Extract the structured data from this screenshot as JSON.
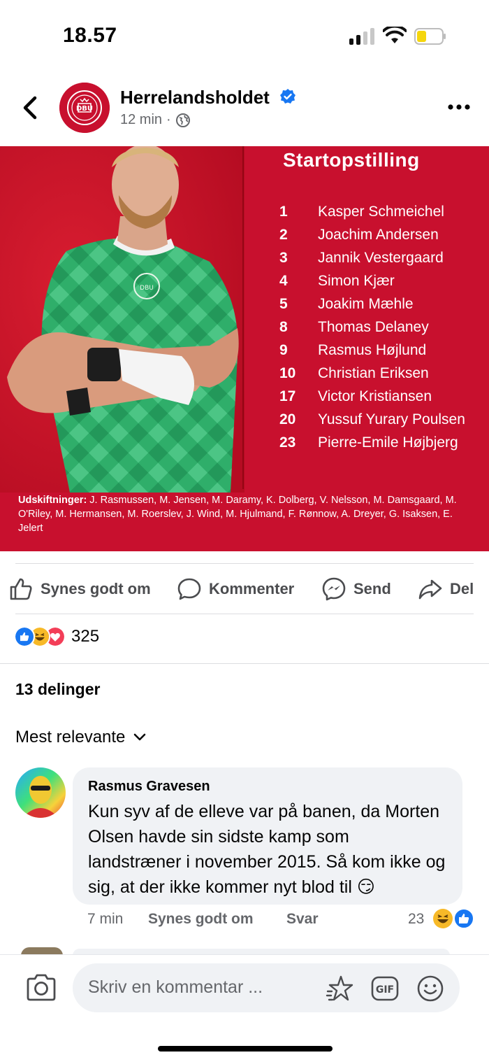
{
  "status_bar": {
    "time": "18.57"
  },
  "post": {
    "page_name": "Herrelandsholdet",
    "age": "12 min",
    "dot": "·"
  },
  "graphic": {
    "title": "Startopstilling",
    "lineup": [
      {
        "num": "1",
        "name": "Kasper Schmeichel"
      },
      {
        "num": "2",
        "name": "Joachim Andersen"
      },
      {
        "num": "3",
        "name": "Jannik Vestergaard"
      },
      {
        "num": "4",
        "name": "Simon Kjær"
      },
      {
        "num": "5",
        "name": "Joakim Mæhle"
      },
      {
        "num": "8",
        "name": "Thomas Delaney"
      },
      {
        "num": "9",
        "name": "Rasmus Højlund"
      },
      {
        "num": "10",
        "name": "Christian Eriksen"
      },
      {
        "num": "17",
        "name": "Victor Kristiansen"
      },
      {
        "num": "20",
        "name": "Yussuf Yurary Poulsen"
      },
      {
        "num": "23",
        "name": "Pierre-Emile Højbjerg"
      }
    ],
    "subs_label": "Udskiftninger:",
    "subs_text": " J. Rasmussen, M. Jensen, M. Daramy, K. Dolberg, V. Nelsson, M. Damsgaard, M. O'Riley, M. Hermansen, M. Roerslev, J. Wind, M. Hjulmand, F. Rønnow, A. Dreyer, G. Isaksen, E. Jelert"
  },
  "actions": {
    "like": "Synes godt om",
    "comment": "Kommenter",
    "send": "Send",
    "share": "Del"
  },
  "reactions": {
    "count": "325"
  },
  "shares": "13 delinger",
  "sort": "Mest relevante",
  "comment": {
    "author": "Rasmus Gravesen",
    "text": "Kun syv af de elleve var på banen, da Morten Olsen havde sin sidste kamp som landstræner i november 2015. Så kom ikke og sig, at der ikke kommer nyt blod til 😏",
    "age": "7 min",
    "like": "Synes godt om",
    "reply": "Svar",
    "reaction_count": "23"
  },
  "composer": {
    "placeholder": "Skriv en kommentar ..."
  },
  "colors": {
    "brand_red": "#c8102e",
    "fb_blue": "#1877f2",
    "jersey_green": "#2fae6a"
  }
}
